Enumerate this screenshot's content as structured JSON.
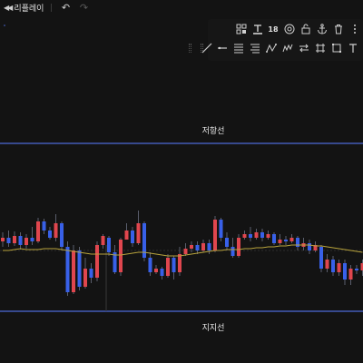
{
  "topbar": {
    "replay_label": "리플레이",
    "replay_icon": "rewind-icon",
    "undo_icon": "undo-icon",
    "redo_icon": "redo-icon"
  },
  "toolbar": {
    "font_size": "18",
    "row1_icons": [
      "layout-icon",
      "text-underline-icon",
      "font-size-icon",
      "target-icon",
      "lock-icon",
      "anchor-icon",
      "trash-icon",
      "more-icon"
    ],
    "row2_icons": [
      "trend-line-icon",
      "horizontal-ray-icon",
      "parallel-lines-icon",
      "fib-retracement-icon",
      "pattern-icon",
      "zigzag-icon",
      "arrows-icon",
      "channel-icon",
      "rectangle-icon",
      "text-tool-icon"
    ]
  },
  "chart": {
    "resistance_label": "저항선",
    "support_label": "지지선",
    "colors": {
      "up": "#e0464e",
      "down": "#3860e8",
      "line": "#4d6ad8",
      "ma": "#b8a33c",
      "wick": "#6e7385"
    }
  },
  "chart_data": {
    "type": "candlestick",
    "annotations": [
      "저항선",
      "지지선"
    ],
    "candles": [
      {
        "o": 266,
        "c": 262,
        "h": 256,
        "l": 272
      },
      {
        "o": 262,
        "c": 268,
        "h": 254,
        "l": 272
      },
      {
        "o": 268,
        "c": 260,
        "h": 255,
        "l": 271
      },
      {
        "o": 260,
        "c": 270,
        "h": 256,
        "l": 275
      },
      {
        "o": 270,
        "c": 262,
        "h": 258,
        "l": 274
      },
      {
        "o": 262,
        "c": 266,
        "h": 250,
        "l": 270
      },
      {
        "o": 266,
        "c": 244,
        "h": 240,
        "l": 268
      },
      {
        "o": 244,
        "c": 254,
        "h": 241,
        "l": 258
      },
      {
        "o": 254,
        "c": 262,
        "h": 250,
        "l": 264
      },
      {
        "o": 262,
        "c": 246,
        "h": 236,
        "l": 266
      },
      {
        "o": 246,
        "c": 272,
        "h": 244,
        "l": 276
      },
      {
        "o": 272,
        "c": 322,
        "h": 266,
        "l": 326
      },
      {
        "o": 322,
        "c": 276,
        "h": 270,
        "l": 324
      },
      {
        "o": 276,
        "c": 316,
        "h": 272,
        "l": 320
      },
      {
        "o": 316,
        "c": 296,
        "h": 284,
        "l": 318
      },
      {
        "o": 296,
        "c": 306,
        "h": 290,
        "l": 312
      },
      {
        "o": 306,
        "c": 270,
        "h": 266,
        "l": 310
      },
      {
        "o": 270,
        "c": 260,
        "h": 258,
        "l": 274
      },
      {
        "o": 262,
        "c": 278,
        "h": 260,
        "l": 282
      },
      {
        "o": 278,
        "c": 300,
        "h": 270,
        "l": 302
      },
      {
        "o": 300,
        "c": 264,
        "h": 262,
        "l": 304
      },
      {
        "o": 264,
        "c": 254,
        "h": 246,
        "l": 258
      },
      {
        "o": 254,
        "c": 268,
        "h": 250,
        "l": 272
      },
      {
        "o": 268,
        "c": 246,
        "h": 232,
        "l": 270
      },
      {
        "o": 246,
        "c": 284,
        "h": 244,
        "l": 288
      },
      {
        "o": 284,
        "c": 300,
        "h": 278,
        "l": 304
      },
      {
        "o": 300,
        "c": 296,
        "h": 292,
        "l": 302
      },
      {
        "o": 296,
        "c": 304,
        "h": 294,
        "l": 308
      },
      {
        "o": 304,
        "c": 284,
        "h": 280,
        "l": 306
      },
      {
        "o": 284,
        "c": 300,
        "h": 282,
        "l": 308
      },
      {
        "o": 300,
        "c": 280,
        "h": 272,
        "l": 304
      },
      {
        "o": 280,
        "c": 274,
        "h": 268,
        "l": 282
      },
      {
        "o": 274,
        "c": 270,
        "h": 266,
        "l": 278
      },
      {
        "o": 270,
        "c": 276,
        "h": 266,
        "l": 280
      },
      {
        "o": 276,
        "c": 268,
        "h": 264,
        "l": 278
      },
      {
        "o": 268,
        "c": 276,
        "h": 264,
        "l": 280
      },
      {
        "o": 276,
        "c": 242,
        "h": 238,
        "l": 278
      },
      {
        "o": 242,
        "c": 262,
        "h": 240,
        "l": 266
      },
      {
        "o": 262,
        "c": 272,
        "h": 256,
        "l": 276
      },
      {
        "o": 272,
        "c": 282,
        "h": 262,
        "l": 284
      },
      {
        "o": 282,
        "c": 262,
        "h": 258,
        "l": 284
      },
      {
        "o": 262,
        "c": 258,
        "h": 254,
        "l": 264
      },
      {
        "o": 258,
        "c": 262,
        "h": 250,
        "l": 266
      },
      {
        "o": 262,
        "c": 256,
        "h": 252,
        "l": 264
      },
      {
        "o": 256,
        "c": 262,
        "h": 252,
        "l": 266
      },
      {
        "o": 262,
        "c": 258,
        "h": 254,
        "l": 264
      },
      {
        "o": 258,
        "c": 268,
        "h": 256,
        "l": 270
      },
      {
        "o": 268,
        "c": 264,
        "h": 258,
        "l": 270
      },
      {
        "o": 264,
        "c": 266,
        "h": 260,
        "l": 270
      },
      {
        "o": 266,
        "c": 262,
        "h": 258,
        "l": 268
      },
      {
        "o": 262,
        "c": 272,
        "h": 260,
        "l": 276
      },
      {
        "o": 272,
        "c": 268,
        "h": 262,
        "l": 276
      },
      {
        "o": 268,
        "c": 276,
        "h": 264,
        "l": 280
      },
      {
        "o": 276,
        "c": 270,
        "h": 266,
        "l": 278
      },
      {
        "o": 272,
        "c": 296,
        "h": 270,
        "l": 300
      },
      {
        "o": 296,
        "c": 286,
        "h": 280,
        "l": 300
      },
      {
        "o": 286,
        "c": 300,
        "h": 282,
        "l": 304
      },
      {
        "o": 300,
        "c": 290,
        "h": 286,
        "l": 304
      },
      {
        "o": 290,
        "c": 308,
        "h": 286,
        "l": 314
      },
      {
        "o": 308,
        "c": 296,
        "h": 292,
        "l": 314
      },
      {
        "o": 296,
        "c": 298,
        "h": 292,
        "l": 302
      },
      {
        "o": 298,
        "c": 290,
        "h": 286,
        "l": 304
      }
    ],
    "ma": [
      276,
      276,
      275,
      274,
      275,
      275,
      275,
      274,
      274,
      274,
      275,
      276,
      277,
      278,
      279,
      280,
      280,
      280,
      280,
      281,
      281,
      280,
      279,
      278,
      278,
      279,
      280,
      281,
      282,
      282,
      282,
      281,
      280,
      279,
      278,
      277,
      276,
      276,
      275,
      275,
      275,
      274,
      274,
      273,
      273,
      272,
      272,
      271,
      271,
      270,
      270,
      270,
      270,
      271,
      271,
      272,
      273,
      274,
      275,
      276,
      277,
      278
    ],
    "resistance_level": 158,
    "support_level": 343
  }
}
